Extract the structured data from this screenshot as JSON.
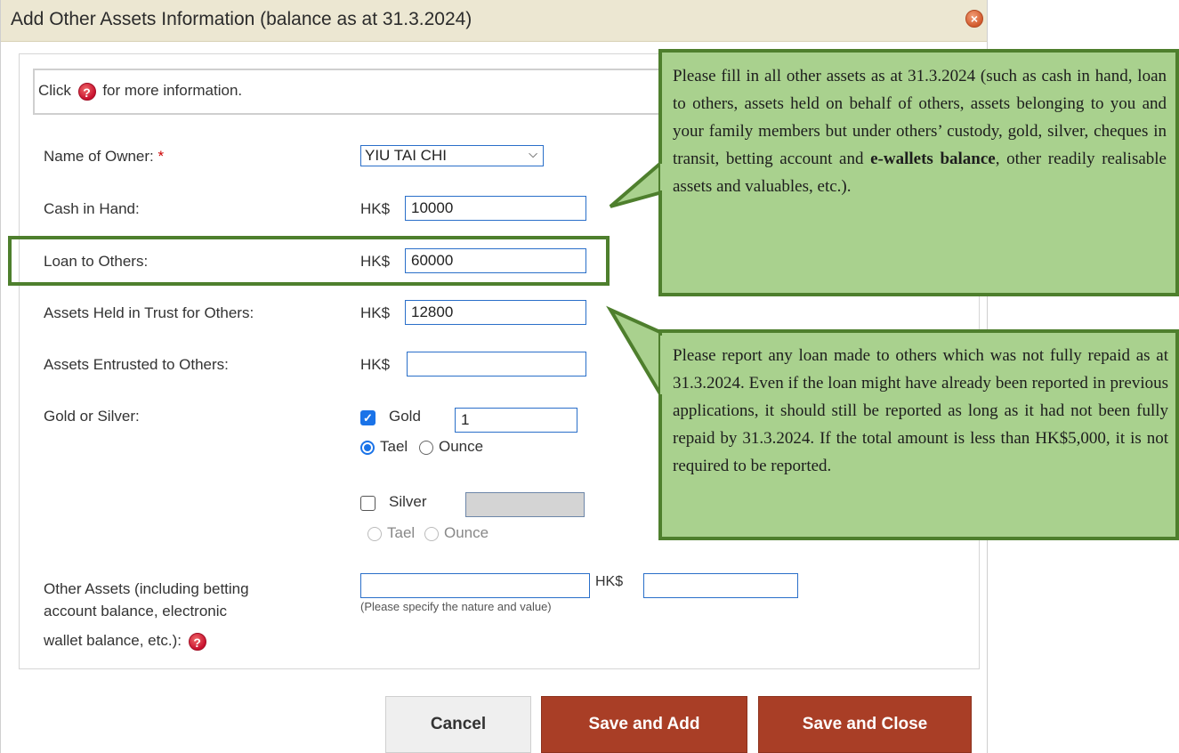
{
  "dialog": {
    "title": "Add Other Assets Information (balance as at 31.3.2024)",
    "close_icon": "close-icon"
  },
  "info": {
    "prefix": "Click",
    "suffix": "for more information.",
    "icon": "question-icon"
  },
  "form": {
    "owner": {
      "label": "Name of Owner:",
      "required_mark": "*",
      "value": "YIU TAI CHI"
    },
    "cash": {
      "label": "Cash in Hand:",
      "currency": "HK$",
      "value": "10000"
    },
    "loan": {
      "label": "Loan to Others:",
      "currency": "HK$",
      "value": "60000"
    },
    "trust": {
      "label": "Assets Held in Trust for Others:",
      "currency": "HK$",
      "value": "12800"
    },
    "entrusted": {
      "label": "Assets Entrusted to Others:",
      "currency": "HK$",
      "value": ""
    },
    "gold_silver": {
      "label": "Gold or Silver:",
      "gold": {
        "label": "Gold",
        "checked": true,
        "value": "1",
        "unit": "Tael",
        "unit_options": [
          "Tael",
          "Ounce"
        ]
      },
      "silver": {
        "label": "Silver",
        "checked": false,
        "value": "",
        "unit_options": [
          "Tael",
          "Ounce"
        ]
      }
    },
    "other": {
      "label_line1": "Other Assets (including betting",
      "label_line2": "account balance, electronic",
      "label_line3": "wallet balance, etc.):",
      "currency": "HK$",
      "nature_value": "",
      "amount_value": "",
      "hint": "(Please specify the nature and value)"
    }
  },
  "buttons": {
    "cancel": "Cancel",
    "save_add": "Save and Add",
    "save_close": "Save and Close"
  },
  "callouts": {
    "first_text": "Please fill in all other assets as at 31.3.2024 (such as cash in hand, loan to others, assets held on behalf of others, assets belonging to you and your family members but under others’ custody, gold, silver, cheques in transit, betting account and",
    "first_bold": "e-wallets balance",
    "first_tail": ", other readily realisable assets and valuables, etc.).",
    "second_text": "Please report any loan made to others which was not fully repaid as at 31.3.2024.   Even if the loan might have already been reported in previous applications, it should still be reported as long as it had not been fully repaid by 31.3.2024.   If the total amount is less than HK$5,000, it is not required to be reported."
  },
  "colors": {
    "titlebar": "#ece7d2",
    "callout_fill": "#a9d18e",
    "callout_border": "#4e7f2d",
    "primary_button": "#a93e26"
  }
}
